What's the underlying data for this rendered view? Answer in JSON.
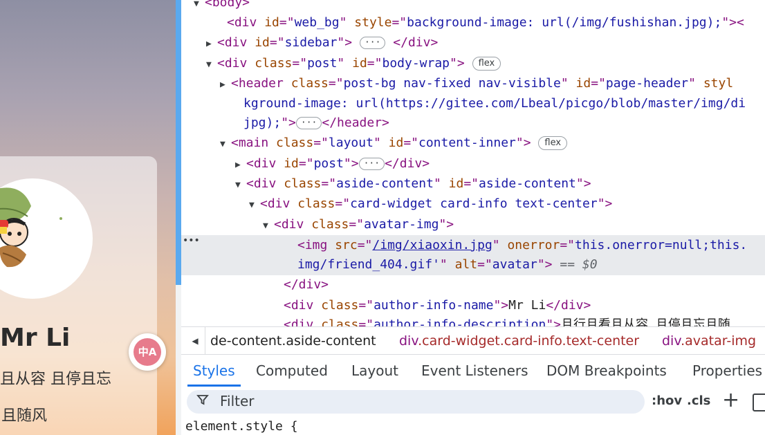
{
  "preview": {
    "author_name": "Mr Li",
    "description_line1": "且从容 且停且忘",
    "description_line2": "且随风",
    "translate_label": "中A"
  },
  "elements_tree": [
    {
      "indent": 36,
      "tri": "▼",
      "html": "<span class=\"tag\">&lt;body&gt;</span>"
    },
    {
      "indent": 66,
      "tri": "",
      "html": "<span class=\"tag\">&lt;div </span><span class=\"an\">id</span><span class=\"tag\">=\"</span><span class=\"av\">web_bg</span><span class=\"tag\">\" </span><span class=\"an\">style</span><span class=\"tag\">=\"</span><span class=\"av\">background-image: url(/img/fushishan.jpg);</span><span class=\"tag\">\"&gt;&lt;</span>"
    },
    {
      "indent": 54,
      "tri": "▶",
      "html": "<span class=\"tag\">&lt;div </span><span class=\"an\">id</span><span class=\"tag\">=\"</span><span class=\"av\">sidebar</span><span class=\"tag\">\"&gt;</span> <span class=\"pill\">···</span> <span class=\"tag\">&lt;/div&gt;</span>"
    },
    {
      "indent": 54,
      "tri": "▼",
      "html": "<span class=\"tag\">&lt;div </span><span class=\"an\">class</span><span class=\"tag\">=\"</span><span class=\"av\">post</span><span class=\"tag\">\" </span><span class=\"an\">id</span><span class=\"tag\">=\"</span><span class=\"av\">body-wrap</span><span class=\"tag\">\"&gt;</span> <span class=\"flex-pill\">flex</span>"
    },
    {
      "indent": 74,
      "tri": "▶",
      "html": "<span class=\"tag\">&lt;header </span><span class=\"an\">class</span><span class=\"tag\">=\"</span><span class=\"av\">post-bg nav-fixed nav-visible</span><span class=\"tag\">\" </span><span class=\"an\">id</span><span class=\"tag\">=\"</span><span class=\"av\">page-header</span><span class=\"tag\">\" </span><span class=\"an\">styl</span>"
    },
    {
      "indent": 90,
      "tri": "",
      "html": "<span class=\"av\">kground-image: url(https://gitee.com/Lbeal/picgo/blob/master/img/di</span>"
    },
    {
      "indent": 90,
      "tri": "",
      "html": "<span class=\"av\">jpg);</span><span class=\"tag\">\"&gt;</span><span class=\"pill\">···</span><span class=\"tag\">&lt;/header&gt;</span>"
    },
    {
      "indent": 74,
      "tri": "▼",
      "html": "<span class=\"tag\">&lt;main </span><span class=\"an\">class</span><span class=\"tag\">=\"</span><span class=\"av\">layout</span><span class=\"tag\">\" </span><span class=\"an\">id</span><span class=\"tag\">=\"</span><span class=\"av\">content-inner</span><span class=\"tag\">\"&gt;</span> <span class=\"flex-pill\">flex</span>"
    },
    {
      "indent": 96,
      "tri": "▶",
      "html": "<span class=\"tag\">&lt;div </span><span class=\"an\">id</span><span class=\"tag\">=\"</span><span class=\"av\">post</span><span class=\"tag\">\"&gt;</span><span class=\"pill\">···</span><span class=\"tag\">&lt;/div&gt;</span>"
    },
    {
      "indent": 96,
      "tri": "▼",
      "html": "<span class=\"tag\">&lt;div </span><span class=\"an\">class</span><span class=\"tag\">=\"</span><span class=\"av\">aside-content</span><span class=\"tag\">\" </span><span class=\"an\">id</span><span class=\"tag\">=\"</span><span class=\"av\">aside-content</span><span class=\"tag\">\"&gt;</span>"
    },
    {
      "indent": 116,
      "tri": "▼",
      "html": "<span class=\"tag\">&lt;div </span><span class=\"an\">class</span><span class=\"tag\">=\"</span><span class=\"av\">card-widget card-info text-center</span><span class=\"tag\">\"&gt;</span>"
    },
    {
      "indent": 136,
      "tri": "▼",
      "html": "<span class=\"tag\">&lt;div </span><span class=\"an\">class</span><span class=\"tag\">=\"</span><span class=\"av\">avatar-img</span><span class=\"tag\">\"&gt;</span>"
    },
    {
      "indent": 168,
      "tri": "",
      "html": "<span class=\"tag\">&lt;img </span><span class=\"an\">src</span><span class=\"tag\">=\"</span><span class=\"link\">/img/xiaoxin.jpg</span><span class=\"tag\">\" </span><span class=\"an\">onerror</span><span class=\"tag\">=\"</span><span class=\"av\">this.onerror=null;this.</span>"
    },
    {
      "indent": 168,
      "tri": "",
      "html": "<span class=\"av\">img/friend_404.gif'</span><span class=\"tag\">\" </span><span class=\"an\">alt</span><span class=\"tag\">=\"</span><span class=\"av\">avatar</span><span class=\"tag\">\"&gt;</span> <span class=\"dim\">== $0</span>"
    },
    {
      "indent": 148,
      "tri": "",
      "html": "<span class=\"tag\">&lt;/div&gt;</span>"
    },
    {
      "indent": 148,
      "tri": "",
      "html": "<span class=\"tag\">&lt;div </span><span class=\"an\">class</span><span class=\"tag\">=\"</span><span class=\"av\">author-info-name</span><span class=\"tag\">\"&gt;</span><span class=\"txt\">Mr Li</span><span class=\"tag\">&lt;/div&gt;</span>"
    },
    {
      "indent": 148,
      "tri": "",
      "html": "<span class=\"tag\">&lt;div </span><span class=\"an\">class</span><span class=\"tag\">=\"</span><span class=\"av\">author-info-description</span><span class=\"tag\">\"&gt;</span><span class=\"txt\">且行且看且从容 且停且忘且随</span>"
    }
  ],
  "breadcrumbs": [
    {
      "tag": "",
      "cls": "de-content.aside-content"
    },
    {
      "tag": "div",
      "cls": ".card-widget.card-info.text-center"
    },
    {
      "tag": "div",
      "cls": ".avatar-img"
    }
  ],
  "tabs": [
    "Styles",
    "Computed",
    "Layout",
    "Event Listeners",
    "DOM Breakpoints",
    "Properties"
  ],
  "active_tab": "Styles",
  "filter": {
    "placeholder": "Filter",
    "hov": ":hov",
    "cls": ".cls",
    "add": "+"
  },
  "element_style": "element.style {",
  "colors": {
    "accent": "#1a73e8",
    "tag": "#881280",
    "attr_name": "#994500",
    "attr_value": "#1a1aa6"
  }
}
